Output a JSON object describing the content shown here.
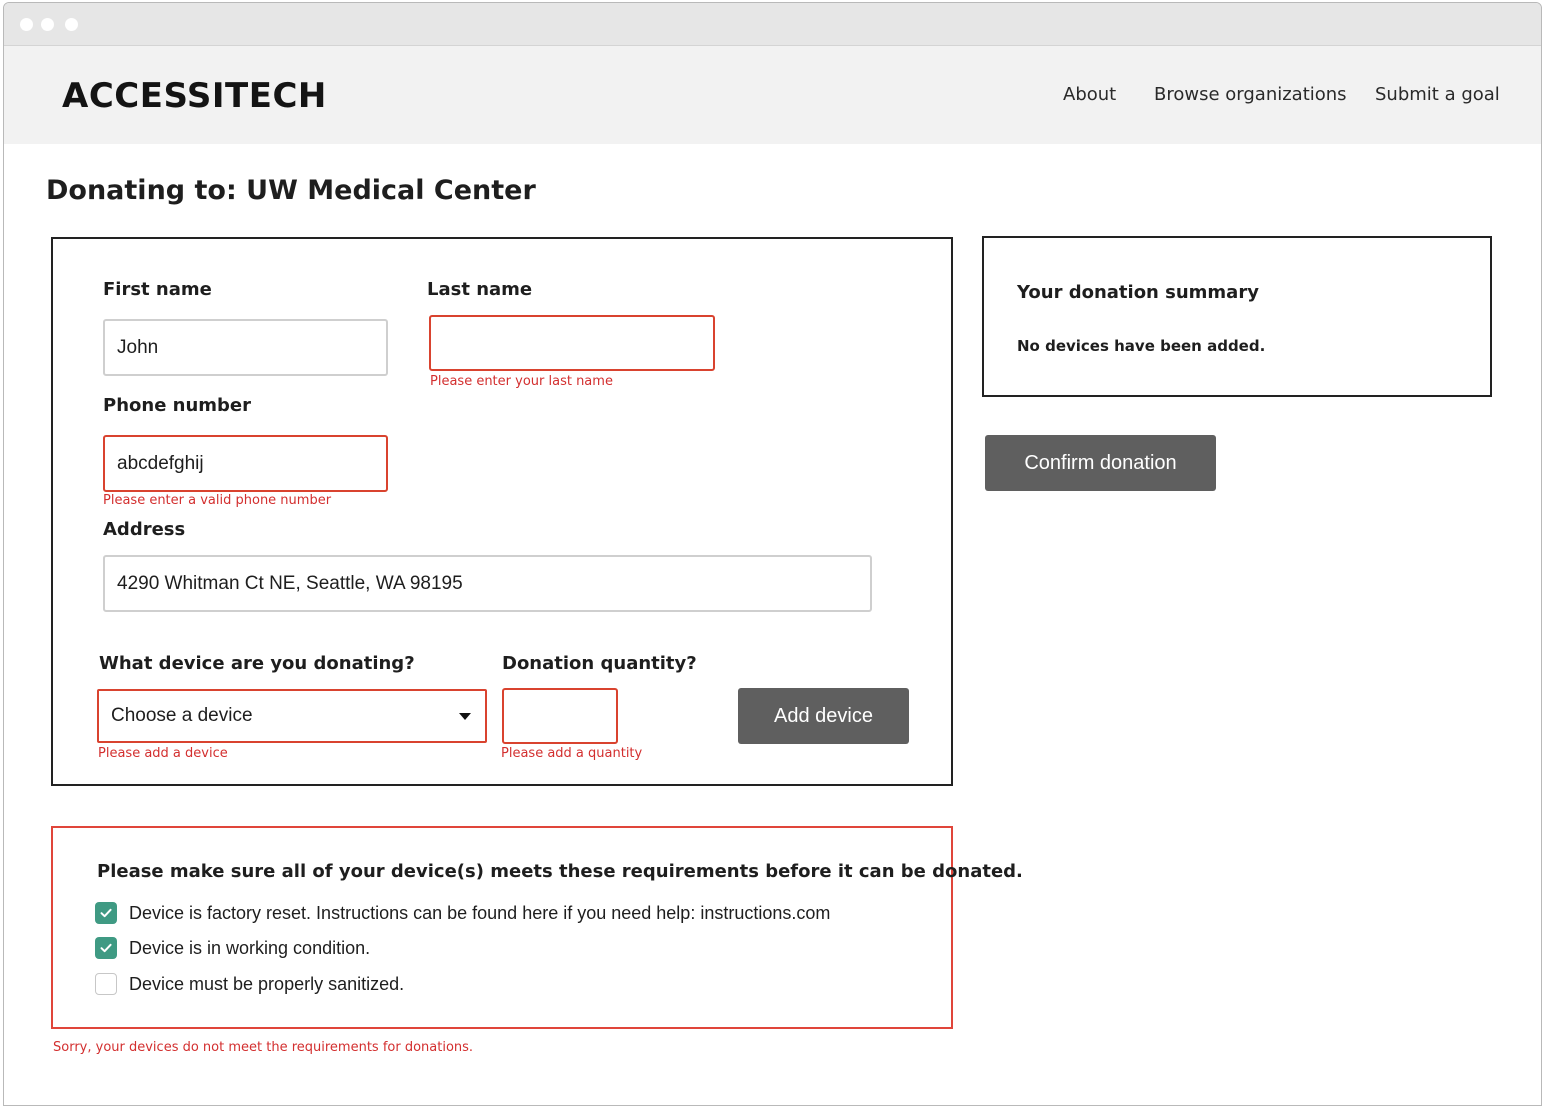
{
  "brand": {
    "logo_text": "ACCESSITECH"
  },
  "nav": {
    "links": [
      {
        "label": "About"
      },
      {
        "label": "Browse organizations"
      },
      {
        "label": "Submit a goal"
      }
    ]
  },
  "page": {
    "title": "Donating to: UW Medical Center"
  },
  "form": {
    "first_name": {
      "label": "First name",
      "value": "John"
    },
    "last_name": {
      "label": "Last name",
      "value": "",
      "error": "Please enter your last name"
    },
    "phone": {
      "label": "Phone number",
      "value": "abcdefghij",
      "error": "Please enter a valid phone number"
    },
    "address": {
      "label": "Address",
      "value": "4290 Whitman Ct NE, Seattle, WA 98195"
    },
    "device": {
      "label": "What device are you donating?",
      "selected": "Choose a device",
      "error": "Please add a device"
    },
    "quantity": {
      "label": "Donation quantity?",
      "value": "",
      "error": "Please add a quantity"
    },
    "add_button": "Add device"
  },
  "summary": {
    "title": "Your donation summary",
    "empty_text": "No devices have been added.",
    "confirm_button": "Confirm donation"
  },
  "requirements": {
    "title": "Please make sure all of your device(s) meets these requirements before it can be donated.",
    "items": [
      {
        "text": "Device is factory reset. Instructions can be found here if you need help: instructions.com",
        "checked": true
      },
      {
        "text": "Device is in working condition.",
        "checked": true
      },
      {
        "text": "Device must be properly sanitized.",
        "checked": false
      }
    ],
    "error": "Sorry, your devices do not meet the requirements for donations."
  },
  "colors": {
    "error": "#d32f2f",
    "checkbox_checked": "#3f9a83",
    "button_bg": "#5f5f5f",
    "navbar_bg": "#f2f2f2"
  }
}
